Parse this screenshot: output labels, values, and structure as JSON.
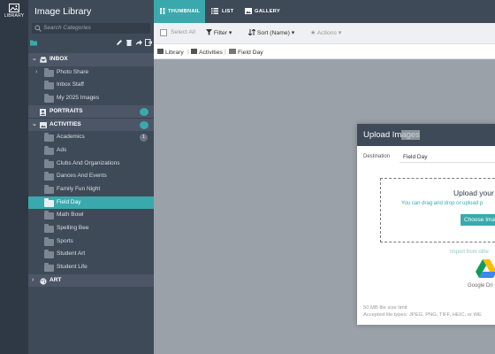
{
  "rail": {
    "library_label": "LIBRARY",
    "icon": "image-library-icon"
  },
  "sidebar": {
    "title": "Image Library",
    "search_placeholder": "Search Categories",
    "tree": [
      {
        "type": "group",
        "label": "INBOX",
        "icon": "inbox-icon",
        "expanded": true
      },
      {
        "type": "item",
        "label": "Photo Share",
        "chevron": true
      },
      {
        "type": "item",
        "label": "Inbox Staff"
      },
      {
        "type": "item",
        "label": "My 2025 Images"
      },
      {
        "type": "group",
        "label": "PORTRAITS",
        "icon": "portrait-icon",
        "right_icon": "cloud-icon"
      },
      {
        "type": "group",
        "label": "ACTIVITIES",
        "icon": "image-icon",
        "expanded": true,
        "right_icon": "tools-icon"
      },
      {
        "type": "item",
        "label": "Academics",
        "badge": "1"
      },
      {
        "type": "item",
        "label": "Ads"
      },
      {
        "type": "item",
        "label": "Clubs And Organizations"
      },
      {
        "type": "item",
        "label": "Dances And Events"
      },
      {
        "type": "item",
        "label": "Family Fun Night"
      },
      {
        "type": "item",
        "label": "Field Day",
        "selected": true
      },
      {
        "type": "item",
        "label": "Math Bowl"
      },
      {
        "type": "item",
        "label": "Spelling Bee"
      },
      {
        "type": "item",
        "label": "Sports"
      },
      {
        "type": "item",
        "label": "Student Art"
      },
      {
        "type": "item",
        "label": "Student Life"
      },
      {
        "type": "group",
        "label": "ART",
        "icon": "palette-icon",
        "expanded": false
      }
    ]
  },
  "tabs": [
    {
      "label": "THUMBNAIL",
      "active": true
    },
    {
      "label": "LIST"
    },
    {
      "label": "GALLERY"
    }
  ],
  "toolbar": {
    "select_all": "Select All",
    "filter": "Filter",
    "sort": "Sort (Name)",
    "actions": "Actions"
  },
  "breadcrumb": [
    "Library",
    "Activities",
    "Field Day"
  ],
  "modal": {
    "title_visible": "Upload Im",
    "title_faded": "ages",
    "destination_label": "Destination",
    "destination_value": "Field Day",
    "drop_title": "Upload your i",
    "drop_hint": "You can drag and drop or upload p",
    "choose_button": "Choose Ima",
    "import_label": "Import from othe",
    "google_drive_label": "Google Dri",
    "size_limit": "50 MB file size limit",
    "file_types": "Accepted file types: JPEG, PNG, TIFF, HEIC, or WE"
  },
  "colors": {
    "accent": "#3aa9ad",
    "sidebar_bg": "#3f4a58",
    "rail_bg": "#2f3845",
    "content_bg": "#9aa1a8"
  }
}
